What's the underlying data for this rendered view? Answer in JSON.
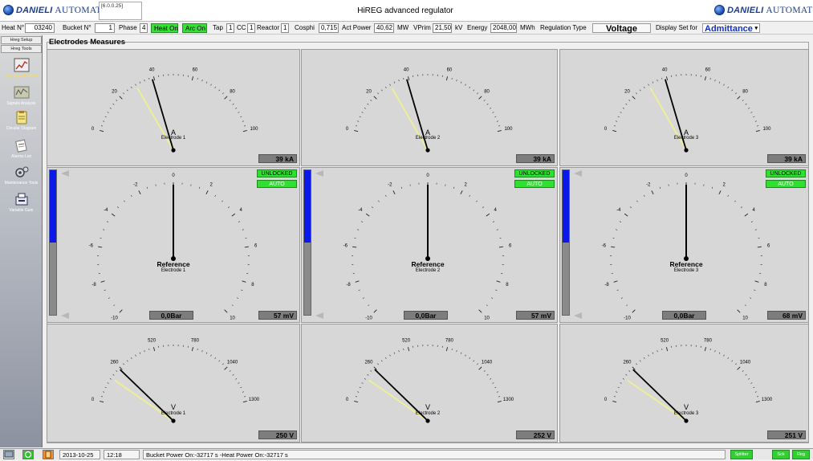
{
  "header": {
    "left_logo_brand": "DANIELI",
    "left_logo_suffix": "AUTOMATION",
    "version": "[6.0.0.25]",
    "app_title": "HiREG advanced regulator",
    "right_logo_brand": "DANIELI",
    "right_logo_suffix": "AUTOMATION"
  },
  "infobar": {
    "heat_label": "Heat N°",
    "heat_value": "03240",
    "bucket_label": "Bucket N°",
    "bucket_value": "1",
    "phase_label": "Phase",
    "phase_value": "4",
    "heat_on": "Heat On",
    "arc_on": "Arc On",
    "tap_label": "Tap",
    "tap_value": "1",
    "cc_label": "CC",
    "cc_value": "1",
    "reactor_label": "Reactor",
    "reactor_value": "1",
    "cosphi_label": "Cosphi",
    "cosphi_value": "0,715",
    "actpower_label": "Act Power",
    "actpower_value": "40,62",
    "actpower_unit": "MW",
    "vprim_label": "VPrim",
    "vprim_value": "21,50",
    "vprim_unit": "kV",
    "energy_label": "Energy",
    "energy_value": "2048,00",
    "energy_unit": "MWh",
    "regtype_label": "Regulation Type",
    "regtype_value": "Voltage",
    "displayset_label": "Display Set for",
    "displayset_value": "Admittance",
    "displayset_arrow": "▾"
  },
  "sidebar": {
    "buttons": [
      "Hreg Setup",
      "Hreg Tools"
    ],
    "nav": [
      {
        "label": "High Speed Trends",
        "icon": "trend-chart-icon",
        "active": true
      },
      {
        "label": "Signals Analysis",
        "icon": "signals-icon",
        "active": false
      },
      {
        "label": "Circular Diagram",
        "icon": "circular-diagram-icon",
        "active": false
      },
      {
        "label": "Alarms List",
        "icon": "alarms-list-icon",
        "active": false
      },
      {
        "label": "Maintenance Tools",
        "icon": "maintenance-tools-icon",
        "active": false
      },
      {
        "label": "Variable Gain",
        "icon": "variable-gain-icon",
        "active": false
      }
    ]
  },
  "main": {
    "group_title": "Electrodes Measures"
  },
  "current_gauges": [
    {
      "unit": "A",
      "electrode": "Electrode 1",
      "readout": "39 kA",
      "value": 39
    },
    {
      "unit": "A",
      "electrode": "Electrode 2",
      "readout": "39 kA",
      "value": 39
    },
    {
      "unit": "A",
      "electrode": "Electrode 3",
      "readout": "39 kA",
      "value": 39
    }
  ],
  "current_scale": {
    "min": 0,
    "max": 100,
    "labels": [
      "0",
      "20",
      "40",
      "60",
      "80",
      "100"
    ],
    "ref": 30
  },
  "reference_gauges": [
    {
      "title": "Reference",
      "electrode": "Electrode 1",
      "pressure": "0,0Bar",
      "readout": "57 mV",
      "lock": "UNLOCKED",
      "mode": "AUTO",
      "value": 0,
      "bar_fill": 0.5
    },
    {
      "title": "Reference",
      "electrode": "Electrode 2",
      "pressure": "0,0Bar",
      "readout": "57 mV",
      "lock": "UNLOCKED",
      "mode": "AUTO",
      "value": 0,
      "bar_fill": 0.5
    },
    {
      "title": "Reference",
      "electrode": "Electrode 3",
      "pressure": "0,0Bar",
      "readout": "68 mV",
      "lock": "UNLOCKED",
      "mode": "AUTO",
      "value": 0,
      "bar_fill": 0.5
    }
  ],
  "reference_scale": {
    "min": -10,
    "max": 10,
    "labels": [
      "-10",
      "-8",
      "-6",
      "-4",
      "-2",
      "0",
      "2",
      "4",
      "6",
      "8",
      "10"
    ]
  },
  "voltage_gauges": [
    {
      "unit": "V",
      "electrode": "Electrode 1",
      "readout": "250 V",
      "value": 250
    },
    {
      "unit": "V",
      "electrode": "Electrode 2",
      "readout": "252 V",
      "value": 252
    },
    {
      "unit": "V",
      "electrode": "Electrode 3",
      "readout": "251 V",
      "value": 251
    }
  ],
  "voltage_scale": {
    "min": 0,
    "max": 1300,
    "labels": [
      "0",
      "260",
      "520",
      "780",
      "1040",
      "1300"
    ],
    "ref": 170
  },
  "colors": {
    "needle": "#000000",
    "ref_needle": "#eeee99",
    "ok_green": "#30e030",
    "bar_blue": "#0a18e8"
  },
  "statusbar": {
    "icons": [
      "display-icon",
      "refresh-icon",
      "exit-icon"
    ],
    "date": "2013-10-25",
    "time": "12:18",
    "message": "Bucket Power On:-32717 s -Heat Power On:-32717 s",
    "indicators": [
      "Splitter",
      "Sck",
      "Reg"
    ]
  }
}
